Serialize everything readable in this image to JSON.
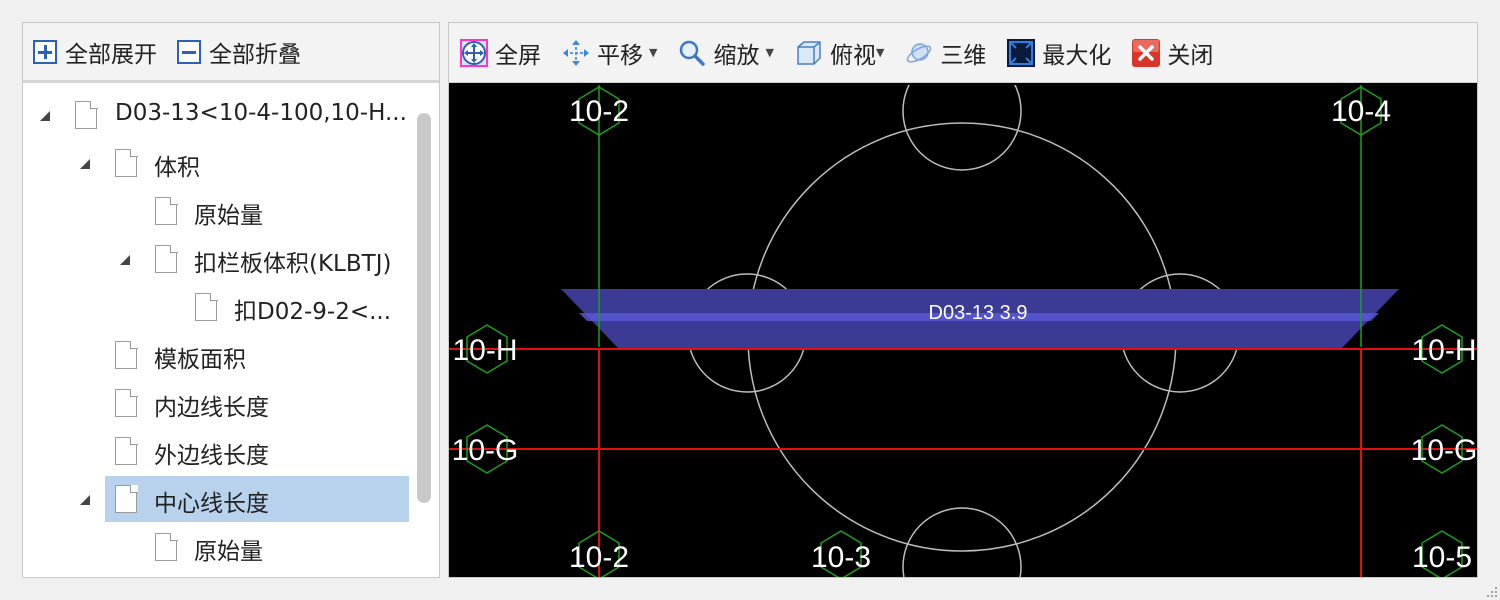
{
  "left_toolbar": {
    "expand_all": "全部展开",
    "collapse_all": "全部折叠"
  },
  "tree": {
    "nodes": [
      {
        "label": "D03-13<10-4-100,10-H...",
        "expanded": true
      },
      {
        "label": "体积",
        "expanded": true
      },
      {
        "label": "原始量"
      },
      {
        "label": "扣栏板体积(KLBTJ)",
        "expanded": true
      },
      {
        "label": "扣D02-9-2<..."
      },
      {
        "label": "模板面积"
      },
      {
        "label": "内边线长度"
      },
      {
        "label": "外边线长度"
      },
      {
        "label": "中心线长度",
        "expanded": true,
        "selected": true
      },
      {
        "label": "原始量"
      }
    ]
  },
  "view_toolbar": {
    "fullscreen": "全屏",
    "pan": "平移",
    "zoom": "缩放",
    "top_view": "俯视",
    "three_d": "三维",
    "maximize": "最大化",
    "close": "关闭"
  },
  "canvas": {
    "axis_labels": {
      "top_left": "10-2",
      "top_right": "10-4",
      "left_h": "10-H",
      "right_h": "10-H",
      "left_g": "10-G",
      "right_g": "10-G",
      "bottom_10_2": "10-2",
      "bottom_10_3": "10-3",
      "bottom_10_5": "10-5"
    },
    "element_label": "D03-13 3.9",
    "colors": {
      "background": "#000000",
      "grid_red": "#e01010",
      "grid_green": "#1fa01f",
      "element_fill": "#3b3b96",
      "element_stripe": "#5a5ad8",
      "circle": "#bdbdbd",
      "label": "#ffffff"
    }
  }
}
